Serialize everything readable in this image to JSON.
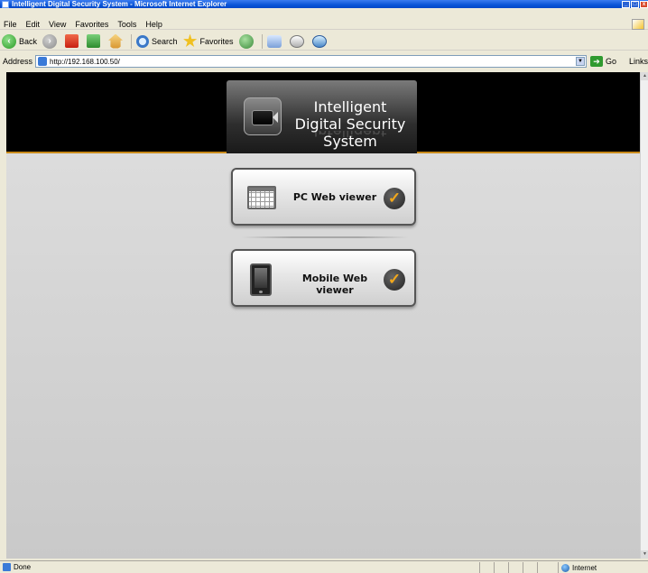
{
  "window": {
    "title": "Intelligent Digital Security System - Microsoft Internet Explorer",
    "min_label": "_",
    "max_label": "□",
    "close_label": "x"
  },
  "menu": [
    "File",
    "Edit",
    "View",
    "Favorites",
    "Tools",
    "Help"
  ],
  "toolbar": {
    "back_label": "Back",
    "search_label": "Search",
    "favorites_label": "Favorites"
  },
  "address": {
    "label": "Address",
    "url": "http://192.168.100.50/",
    "go_label": "Go",
    "links_label": "Links"
  },
  "page": {
    "logo_text": "Intelligent Digital Security System",
    "pc_button_label": "PC  Web viewer",
    "mobile_button_label": "Mobile  Web viewer"
  },
  "status": {
    "text": "Done",
    "zone": "Internet"
  },
  "colors": {
    "header_bg": "#000000",
    "header_accent": "#c98a1a",
    "check_accent": "#f2a81c"
  }
}
